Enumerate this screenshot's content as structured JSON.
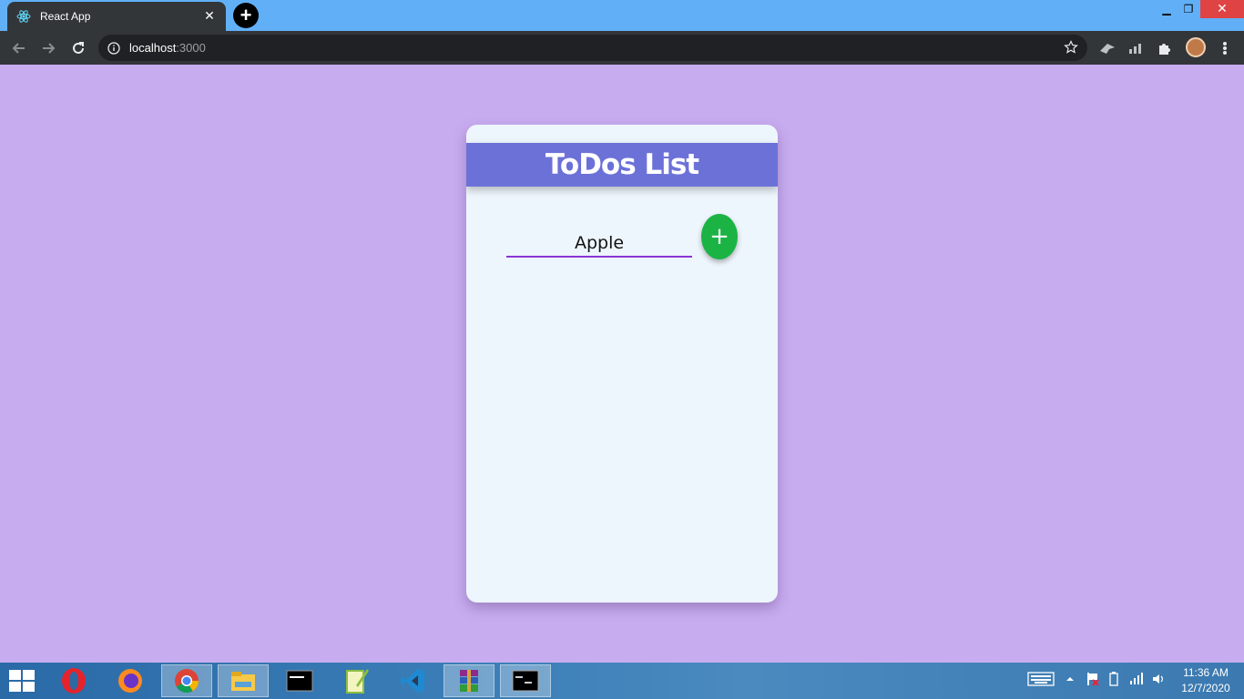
{
  "browser": {
    "tab": {
      "title": "React App",
      "close_glyph": "✕",
      "favicon": "react-icon"
    },
    "new_tab_glyph": "+",
    "window_controls": {
      "minimize": "▁",
      "maximize": "❐",
      "close": "✕"
    },
    "address": {
      "host": "localhost",
      "port": ":3000"
    },
    "nav": {
      "back": "back-arrow-icon",
      "forward": "forward-arrow-icon",
      "reload": "reload-icon"
    },
    "extensions": [
      "extension-bird-icon",
      "extension-chart-icon",
      "puzzle-icon"
    ]
  },
  "app": {
    "title": "ToDos List",
    "input": {
      "value": "Apple"
    },
    "add_button": {
      "label": "+"
    },
    "colors": {
      "background": "#c8acf0",
      "card": "#eef6fd",
      "header": "#6c71d8",
      "add_button": "#1cb345",
      "input_underline": "#8a33d6"
    }
  },
  "taskbar": {
    "apps": [
      "opera-icon",
      "firefox-icon",
      "chrome-icon",
      "file-explorer-icon",
      "mysql-icon",
      "notepad-plus-plus-icon",
      "vscode-icon",
      "winrar-icon",
      "cmd-icon"
    ],
    "active_app": "chrome-icon",
    "clock": {
      "time": "11:36 AM",
      "date": "12/7/2020"
    }
  }
}
